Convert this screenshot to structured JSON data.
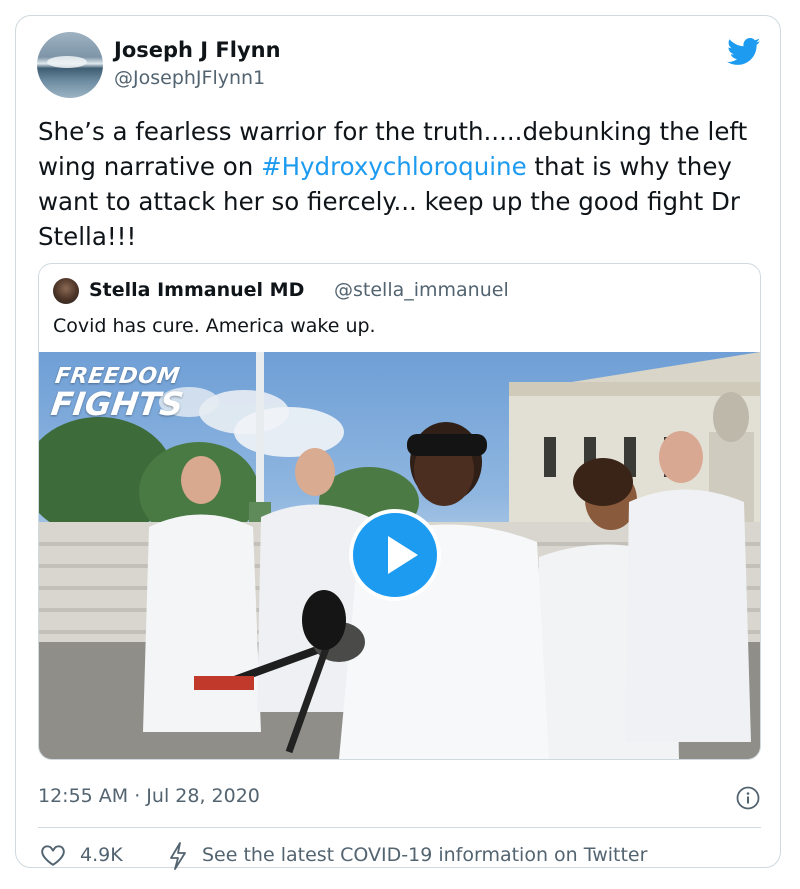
{
  "author": {
    "name": "Joseph J Flynn",
    "handle": "@JosephJFlynn1",
    "avatar_icon": "surfer-avatar"
  },
  "brand_icon": "twitter-bird-icon",
  "tweet": {
    "text_before": "She’s a fearless warrior for the truth.....debunking the left wing narrative on ",
    "hashtag": "#Hydroxychloroquine",
    "text_after": " that is why they want to attack her so fiercely... keep up the good fight Dr Stella!!!"
  },
  "quoted": {
    "name": "Stella Immanuel MD",
    "handle": "@stella_immanuel",
    "text": "Covid has cure. America wake up.",
    "media": {
      "logo_line1": "FREEDOM",
      "logo_line2": "FIGHTS",
      "play_icon": "play-icon"
    }
  },
  "timestamp": "12:55 AM · Jul 28, 2020",
  "actions": {
    "like_count": "4.9K",
    "info_link": "See the latest COVID-19 information on Twitter"
  },
  "colors": {
    "accent": "#1d9bf0",
    "text": "#0f1419",
    "secondary": "#536471",
    "border": "#cfd9de"
  }
}
